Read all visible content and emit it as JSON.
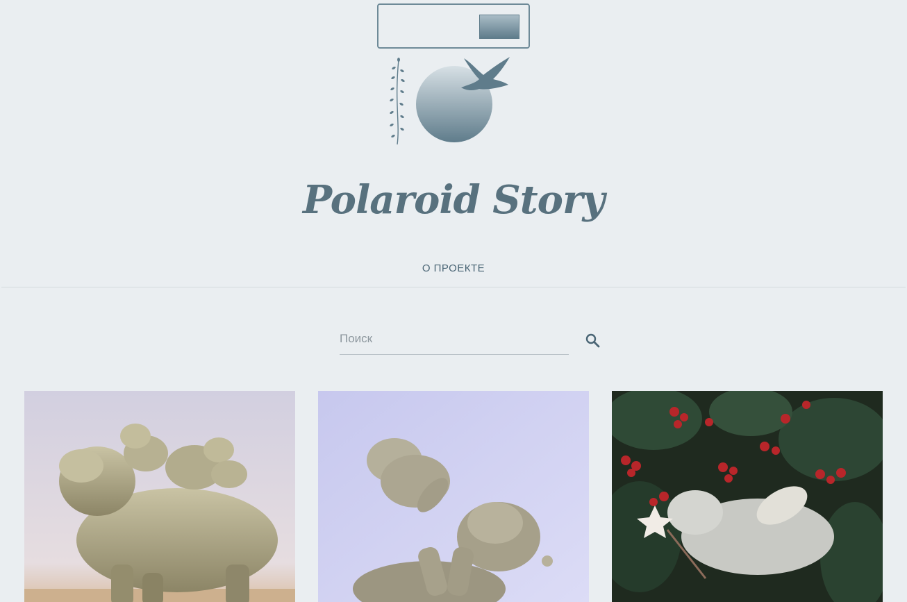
{
  "site": {
    "title": "Polaroid Story"
  },
  "nav": {
    "items": [
      {
        "label": "О ПРОЕКТЕ"
      }
    ]
  },
  "search": {
    "placeholder": "Поиск",
    "value": ""
  },
  "icons": {
    "search": "search-icon",
    "logo": "logo-emblem"
  },
  "colors": {
    "background": "#eaeef1",
    "accent": "#58717e",
    "nav_text": "#4a6575"
  },
  "posts": [
    {
      "image": "hippo-family-figurine"
    },
    {
      "image": "hippo-mother-and-baby-figurine"
    },
    {
      "image": "flying-hippo-with-star-wand"
    }
  ]
}
